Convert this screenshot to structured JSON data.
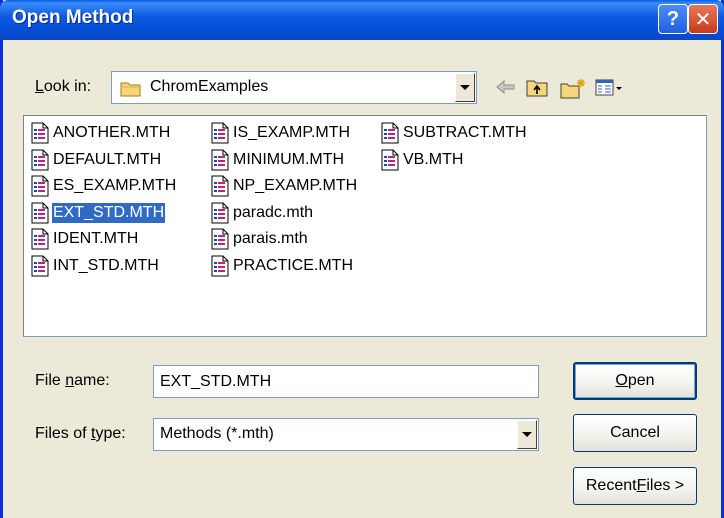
{
  "window": {
    "title": "Open Method",
    "help_label": "?",
    "close_label": "✕"
  },
  "lookin": {
    "label_underlined": "L",
    "label_rest": "ook in:",
    "value": "ChromExamples"
  },
  "toolbar": {
    "icons": [
      "back-arrow-icon",
      "up-folder-icon",
      "new-folder-icon",
      "view-menu-icon"
    ]
  },
  "files": [
    {
      "name": "ANOTHER.MTH"
    },
    {
      "name": "DEFAULT.MTH"
    },
    {
      "name": "ES_EXAMP.MTH"
    },
    {
      "name": "EXT_STD.MTH",
      "selected": true
    },
    {
      "name": "IDENT.MTH"
    },
    {
      "name": "INT_STD.MTH"
    },
    {
      "name": "IS_EXAMP.MTH"
    },
    {
      "name": "MINIMUM.MTH"
    },
    {
      "name": "NP_EXAMP.MTH"
    },
    {
      "name": "paradc.mth"
    },
    {
      "name": "parais.mth"
    },
    {
      "name": "PRACTICE.MTH"
    },
    {
      "name": "SUBTRACT.MTH"
    },
    {
      "name": "VB.MTH"
    }
  ],
  "filename": {
    "label_pre": "File ",
    "label_underlined": "n",
    "label_rest": "ame:",
    "value": "EXT_STD.MTH"
  },
  "filetype": {
    "label_pre": "Files of ",
    "label_underlined": "t",
    "label_rest": "ype:",
    "value": "Methods (*.mth)"
  },
  "buttons": {
    "open_underlined": "O",
    "open_rest": "pen",
    "cancel": "Cancel",
    "recent_pre": "Recent ",
    "recent_underlined": "F",
    "recent_rest": "iles >"
  },
  "colors": {
    "titlebar": "#0450d9",
    "selection": "#316ac5",
    "dialog_bg": "#ece9d8"
  }
}
